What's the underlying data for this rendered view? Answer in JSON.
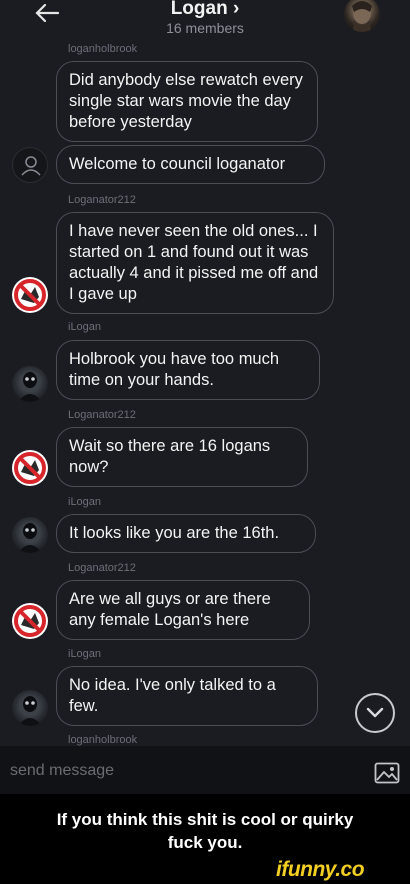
{
  "header": {
    "title": "Logan ›",
    "subtitle": "16 members"
  },
  "messages": [
    {
      "text": "Did anybody else rewatch every single star wars movie the day before yesterday"
    },
    {
      "text": "Welcome to council loganator"
    },
    {
      "text": "I have never seen the old ones... I started on 1 and found out it was actually 4 and it pissed me off and I gave up"
    },
    {
      "text": "Holbrook you have too much time on your hands."
    },
    {
      "text": "Wait so there are 16 logans now?"
    },
    {
      "text": "It looks like you are the 16th."
    },
    {
      "text": "Are we all guys or are there any female Logan's here"
    },
    {
      "text": "No idea. I've only talked to a few."
    }
  ],
  "senders": [
    "loganholbrook",
    "Loganator212",
    "iLogan",
    "Loganator212",
    "iLogan",
    "Loganator212",
    "iLogan",
    "loganholbrook"
  ],
  "composer": {
    "placeholder": "send message"
  },
  "caption": {
    "line1": "If you think this shit is cool or quirky",
    "line2": "fuck you."
  },
  "watermark": "ifunny.co",
  "colors": {
    "background": "#1b1c22",
    "bubble_border": "#4b4d57",
    "sender_text": "#6c6e78",
    "watermark": "#f2cf22"
  }
}
